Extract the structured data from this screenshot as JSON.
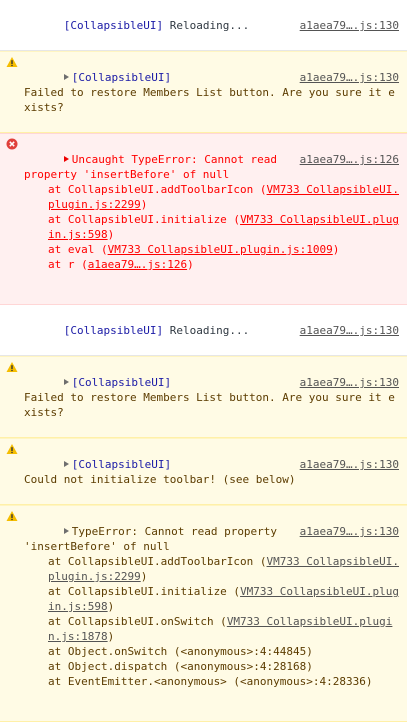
{
  "messages": [
    {
      "level": "log",
      "tag": "[CollapsibleUI]",
      "text": " Reloading...",
      "source": "a1aea79….js:130"
    },
    {
      "level": "warn",
      "icon": "warning-icon",
      "tag": "[CollapsibleUI]",
      "text": "Failed to restore Members List button. Are you sure it exists?",
      "source": "a1aea79….js:130"
    },
    {
      "level": "error",
      "icon": "error-icon",
      "headline": "Uncaught TypeError: Cannot read property 'insertBefore' of null",
      "source": "a1aea79….js:126",
      "stack": [
        {
          "prefix": "at CollapsibleUI.addToolbarIcon (",
          "link": "VM733 CollapsibleUI.plugin.js:2299",
          "suffix": ")"
        },
        {
          "prefix": "at CollapsibleUI.initialize (",
          "link": "VM733 CollapsibleUI.plugin.js:598",
          "suffix": ")"
        },
        {
          "prefix": "at eval (",
          "link": "VM733 CollapsibleUI.plugin.js:1009",
          "suffix": ")"
        },
        {
          "prefix": "at r (",
          "link": "a1aea79….js:126",
          "suffix": ")"
        }
      ]
    },
    {
      "level": "log",
      "tag": "[CollapsibleUI]",
      "text": " Reloading...",
      "source": "a1aea79….js:130"
    },
    {
      "level": "warn",
      "icon": "warning-icon",
      "tag": "[CollapsibleUI]",
      "text": "Failed to restore Members List button. Are you sure it exists?",
      "source": "a1aea79….js:130"
    },
    {
      "level": "warn",
      "icon": "warning-icon",
      "tag": "[CollapsibleUI]",
      "text": "Could not initialize toolbar! (see below)",
      "source": "a1aea79….js:130"
    },
    {
      "level": "warn",
      "icon": "warning-icon",
      "headline": "TypeError: Cannot read property 'insertBefore' of null",
      "source": "a1aea79….js:130",
      "stack": [
        {
          "prefix": "at CollapsibleUI.addToolbarIcon (",
          "link": "VM733 CollapsibleUI.plugin.js:2299",
          "suffix": ")"
        },
        {
          "prefix": "at CollapsibleUI.initialize (",
          "link": "VM733 CollapsibleUI.plugin.js:598",
          "suffix": ")"
        },
        {
          "prefix": "at CollapsibleUI.onSwitch (",
          "link": "VM733 CollapsibleUI.plugin.js:1878",
          "suffix": ")"
        },
        {
          "prefix": "at Object.onSwitch (<anonymous>:4:44845)",
          "link": "",
          "suffix": ""
        },
        {
          "prefix": "at Object.dispatch (<anonymous>:4:28168)",
          "link": "",
          "suffix": ""
        },
        {
          "prefix": "at EventEmitter.<anonymous> (<anonymous>:4:28336)",
          "link": "",
          "suffix": ""
        }
      ]
    }
  ]
}
